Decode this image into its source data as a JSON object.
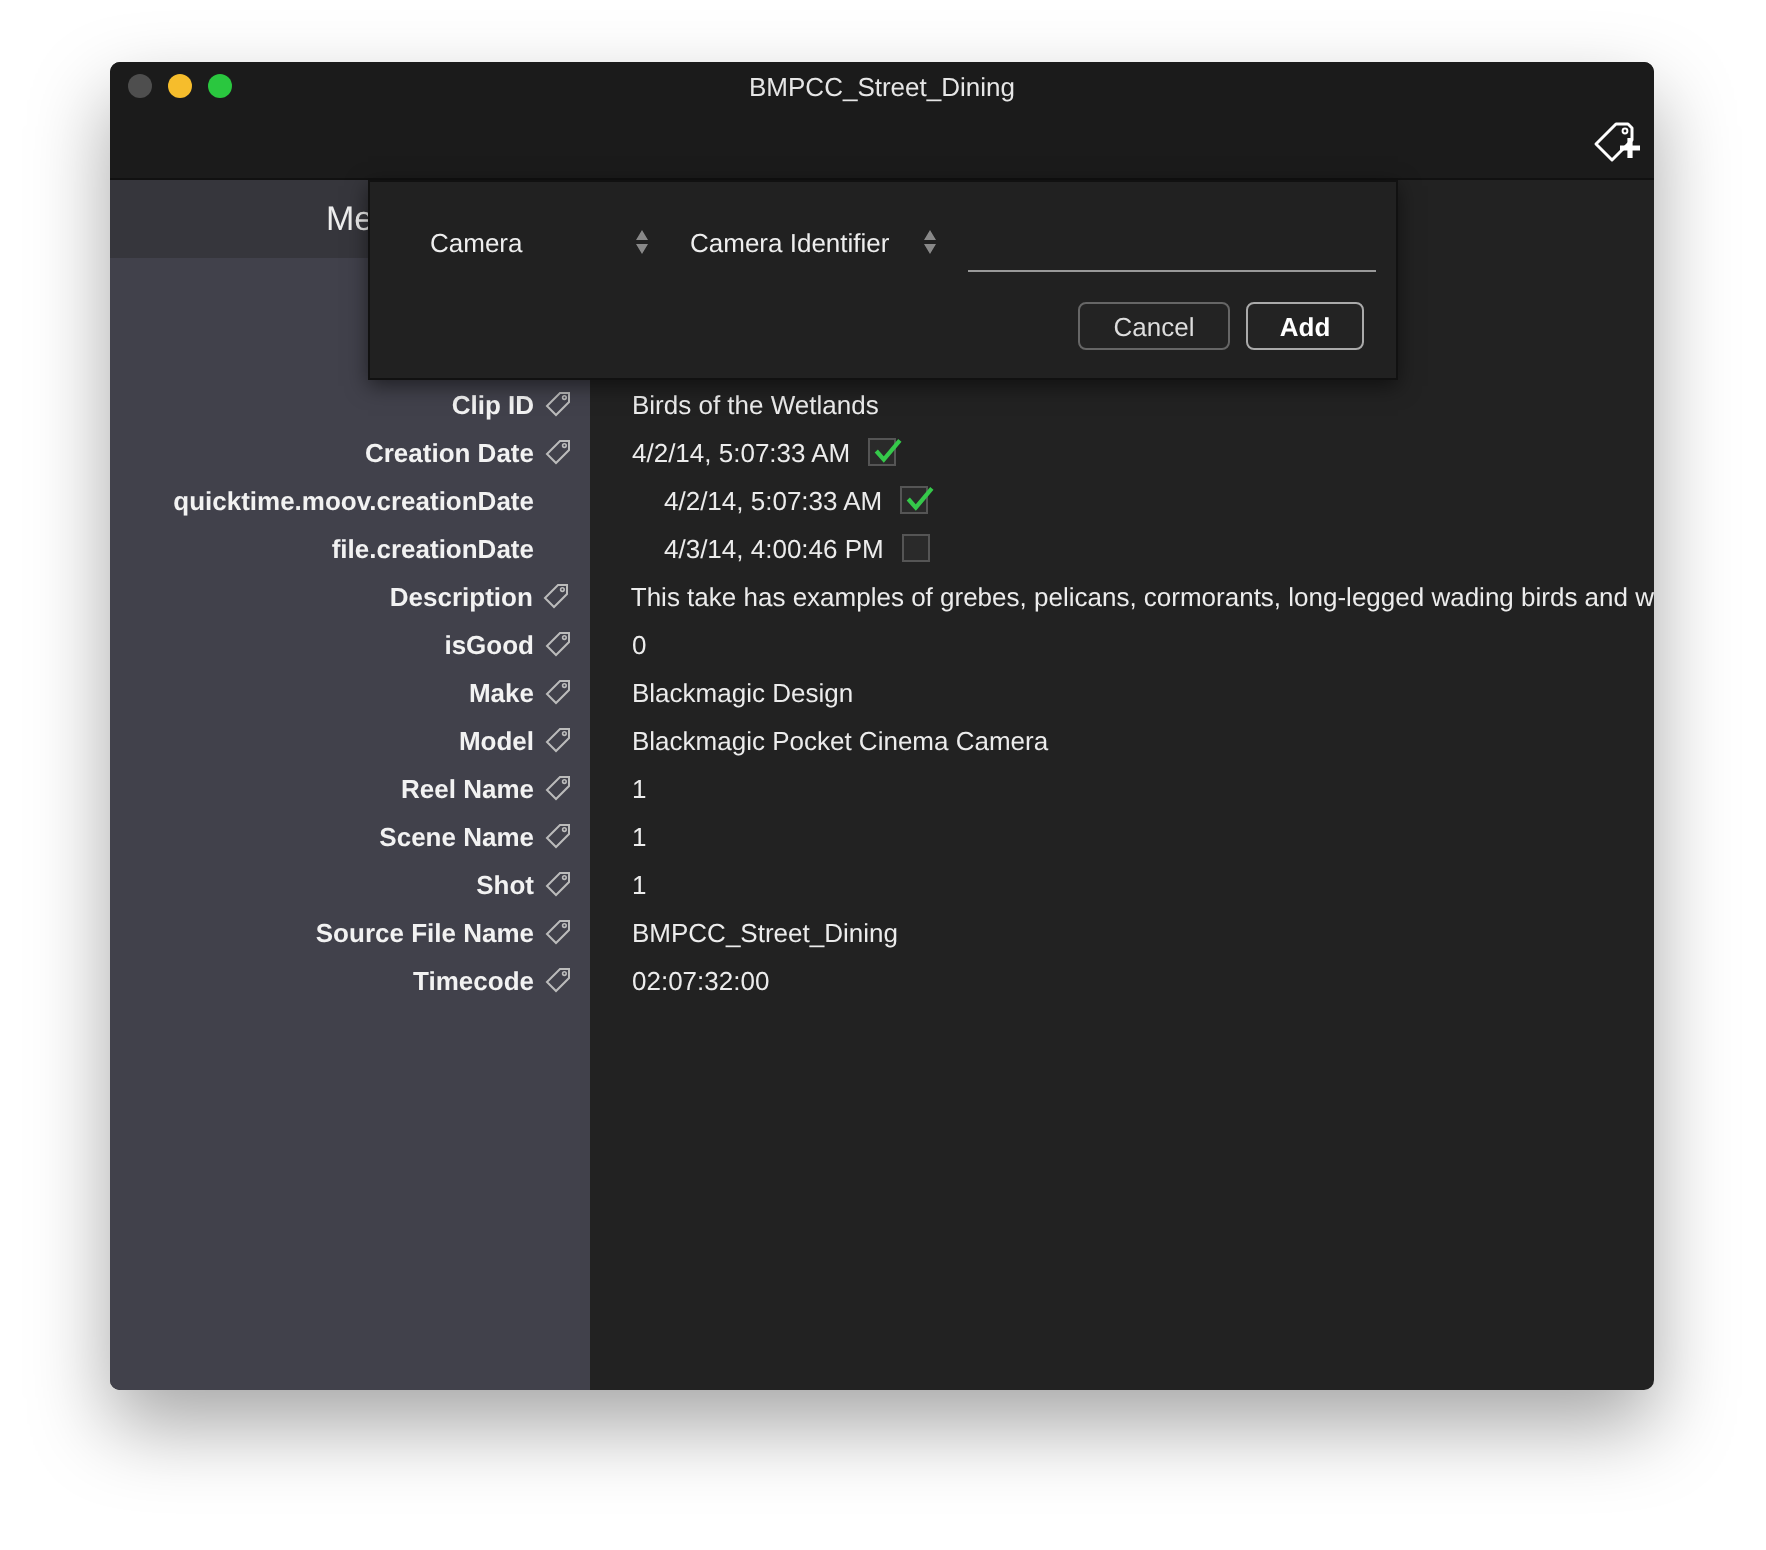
{
  "window": {
    "title": "BMPCC_Street_Dining"
  },
  "sidebar": {
    "header": "Me"
  },
  "rows": [
    {
      "kind": "field",
      "label": "Clip ID",
      "value": "Birds of the Wetlands"
    },
    {
      "kind": "field",
      "label": "Creation Date",
      "value": "4/2/14, 5:07:33 AM",
      "checked": true
    },
    {
      "kind": "source",
      "label": "quicktime.moov.creationDate",
      "value": "4/2/14, 5:07:33 AM",
      "checked": true
    },
    {
      "kind": "source",
      "label": "file.creationDate",
      "value": "4/3/14, 4:00:46 PM",
      "checked": false
    },
    {
      "kind": "field",
      "label": "Description",
      "value": "This take has examples of grebes, pelicans, cormorants, long-legged wading birds and w"
    },
    {
      "kind": "field",
      "label": "isGood",
      "value": "0"
    },
    {
      "kind": "field",
      "label": "Make",
      "value": "Blackmagic Design"
    },
    {
      "kind": "field",
      "label": "Model",
      "value": "Blackmagic Pocket Cinema Camera"
    },
    {
      "kind": "field",
      "label": "Reel Name",
      "value": "1"
    },
    {
      "kind": "field",
      "label": "Scene Name",
      "value": "1"
    },
    {
      "kind": "field",
      "label": "Shot",
      "value": "1"
    },
    {
      "kind": "field",
      "label": "Source File Name",
      "value": "BMPCC_Street_Dining"
    },
    {
      "kind": "field",
      "label": "Timecode",
      "value": "02:07:32:00"
    }
  ],
  "popover": {
    "selects": [
      "Camera",
      "Camera Identifier"
    ],
    "buttons": [
      {
        "label": "Cancel",
        "default": false
      },
      {
        "label": "Add",
        "default": true
      }
    ]
  }
}
